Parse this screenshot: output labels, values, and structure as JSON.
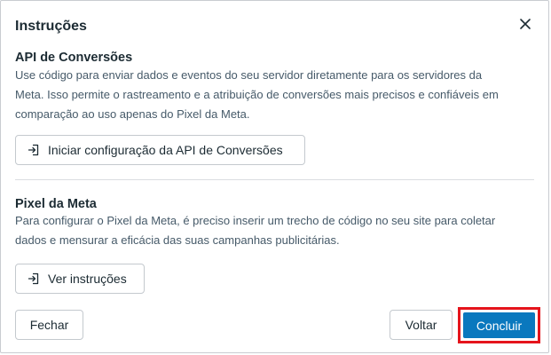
{
  "dialog": {
    "title": "Instruções",
    "close_icon": "close-icon"
  },
  "conversions_api": {
    "heading": "API de Conversões",
    "lines": [
      "Use código para enviar dados e eventos do seu servidor diretamente para os servidores da",
      "Meta. Isso permite o rastreamento e a atribuição de conversões mais precisos e confiáveis em",
      "comparação ao uso apenas do Pixel da Meta."
    ],
    "button_label": "Iniciar configuração da API de Conversões",
    "button_icon": "sign-in-icon"
  },
  "meta_pixel": {
    "heading": "Pixel da Meta",
    "lines": [
      "Para configurar o Pixel da Meta, é preciso inserir um trecho de código no seu site para coletar",
      "dados e mensurar a eficácia das suas campanhas publicitárias."
    ],
    "button_label": "Ver instruções",
    "button_icon": "sign-in-icon"
  },
  "footer": {
    "close_label": "Fechar",
    "back_label": "Voltar",
    "finish_label": "Concluir",
    "highlight_color": "#e5141c",
    "primary_color": "#0a78be"
  }
}
